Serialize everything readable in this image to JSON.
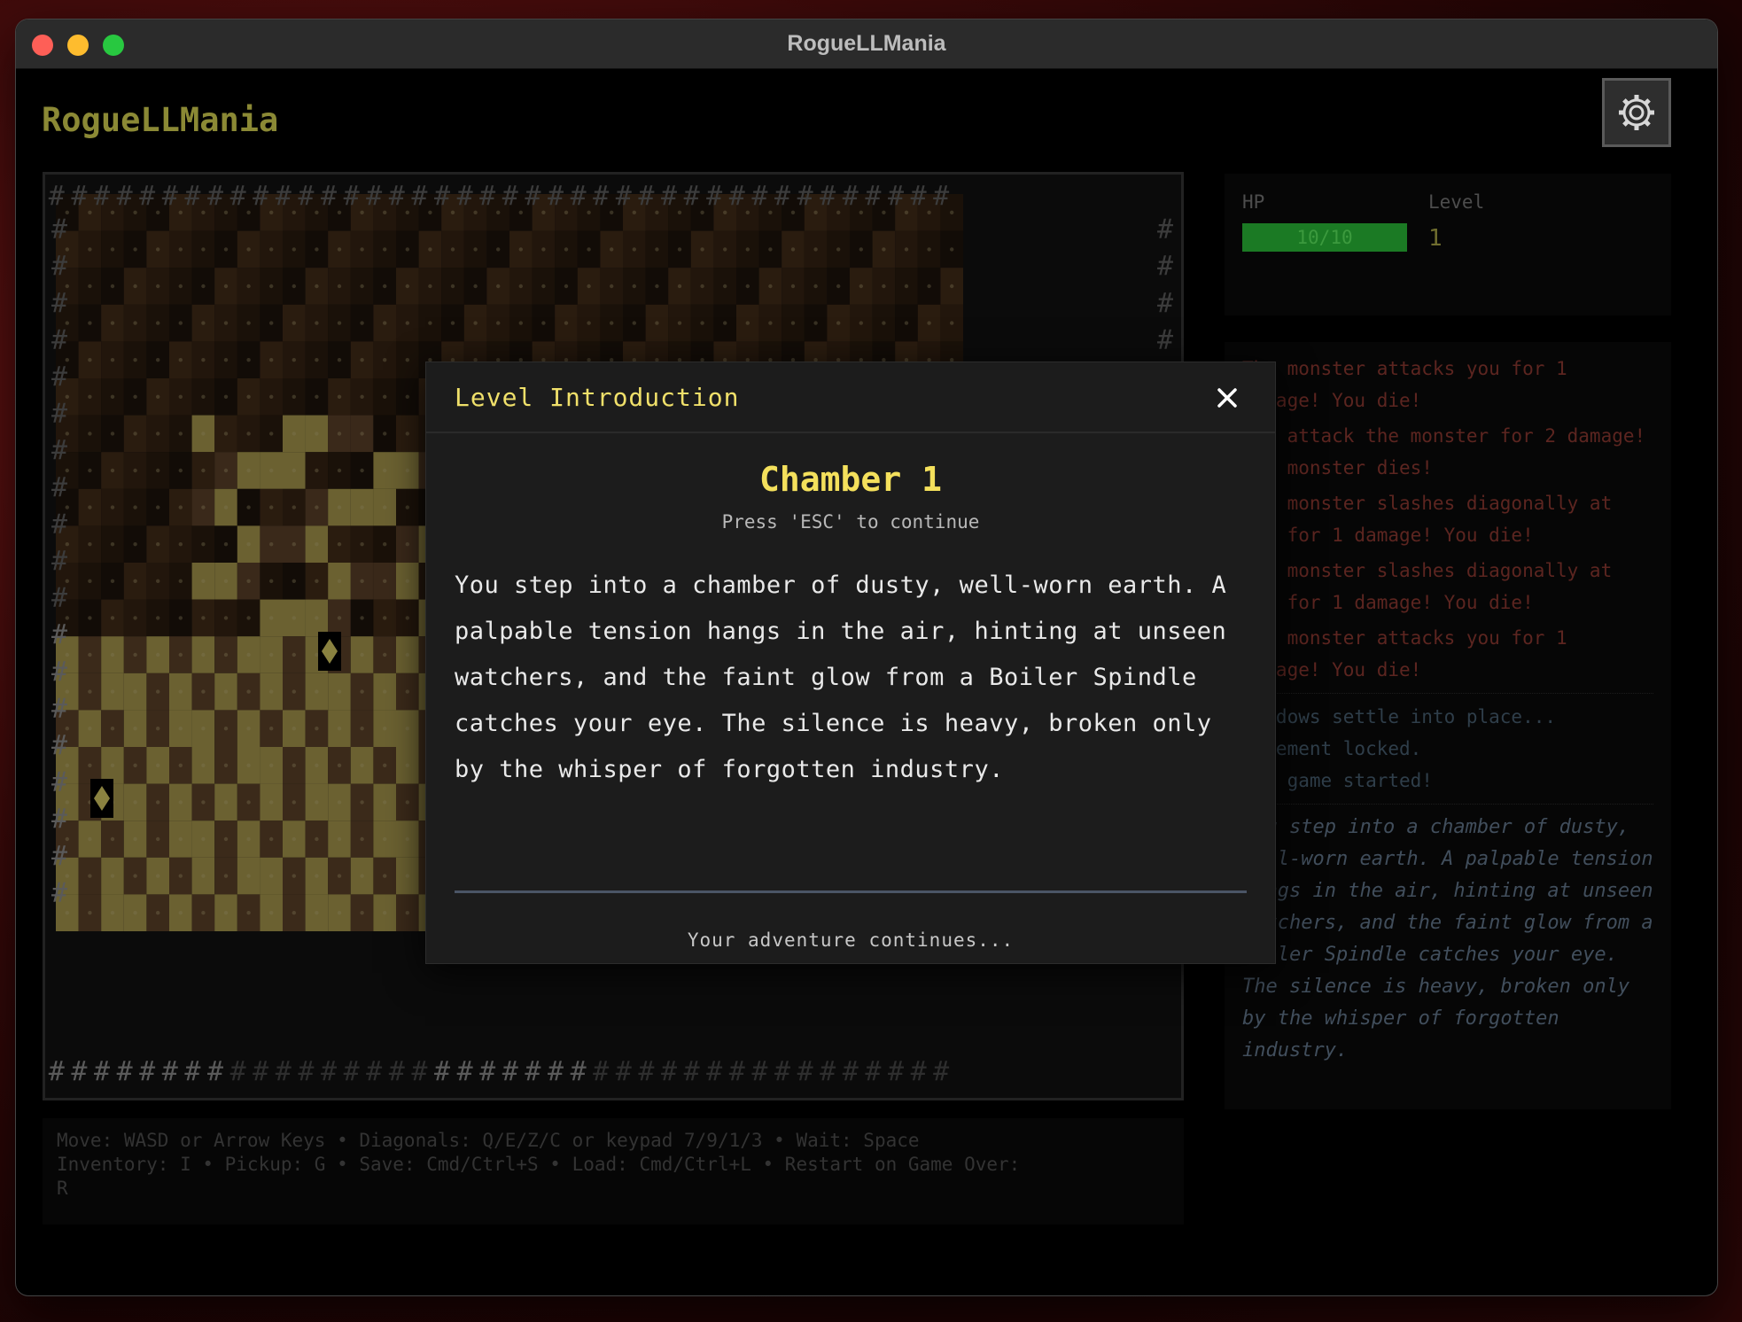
{
  "window": {
    "title": "RogueLLMania"
  },
  "app": {
    "title": "RogueLLMania"
  },
  "icons": {
    "settings": "gear-icon",
    "close": "close-icon",
    "player": "@",
    "item": "diamond-icon",
    "wall": "#"
  },
  "colors": {
    "accent_title": "#f4e05c",
    "app_title": "#8b8935",
    "hp_bar": "#1b7a24",
    "log_damage": "#5c2520",
    "floor_lit": "#6b6131",
    "floor_dim": "#3b2a1a"
  },
  "stats": {
    "hp_label": "HP",
    "hp_value": "10/10",
    "hp_fraction": 1.0,
    "level_label": "Level",
    "level_value": "1"
  },
  "log": {
    "combat": [
      "The monster attacks you for 1 damage! You die!",
      "You attack the monster for 2 damage! The monster dies!",
      "The monster slashes diagonally at you for 1 damage! You die!",
      "The monster slashes diagonally at you for 1 damage! You die!",
      "The monster attacks you for 1 damage! You die!"
    ],
    "system": [
      "Shadows settle into place...",
      "Movement locked.",
      "New game started!"
    ],
    "story": "You step into a chamber of dusty, well-worn earth. A palpable tension hangs in the air, hinting at unseen watchers, and the faint glow from a Boiler Spindle catches your eye. The silence is heavy, broken only by the whisper of forgotten industry."
  },
  "help": {
    "line1": "Move: WASD or Arrow Keys • Diagonals: Q/E/Z/C or keypad 7/9/1/3 • Wait: Space",
    "line2": "Inventory: I • Pickup: G • Save: Cmd/Ctrl+S • Load: Cmd/Ctrl+L • Restart on Game Over:",
    "line3": "R"
  },
  "modal": {
    "title": "Level Introduction",
    "heading": "Chamber 1",
    "hint": "Press 'ESC' to continue",
    "body": "You step into a chamber of dusty, well-worn earth. A palpable tension hangs in the air, hinting at unseen watchers, and the faint glow from a Boiler Spindle catches your eye. The silence is heavy, broken only by the whisper of forgotten industry.",
    "footer": "Your adventure continues..."
  }
}
